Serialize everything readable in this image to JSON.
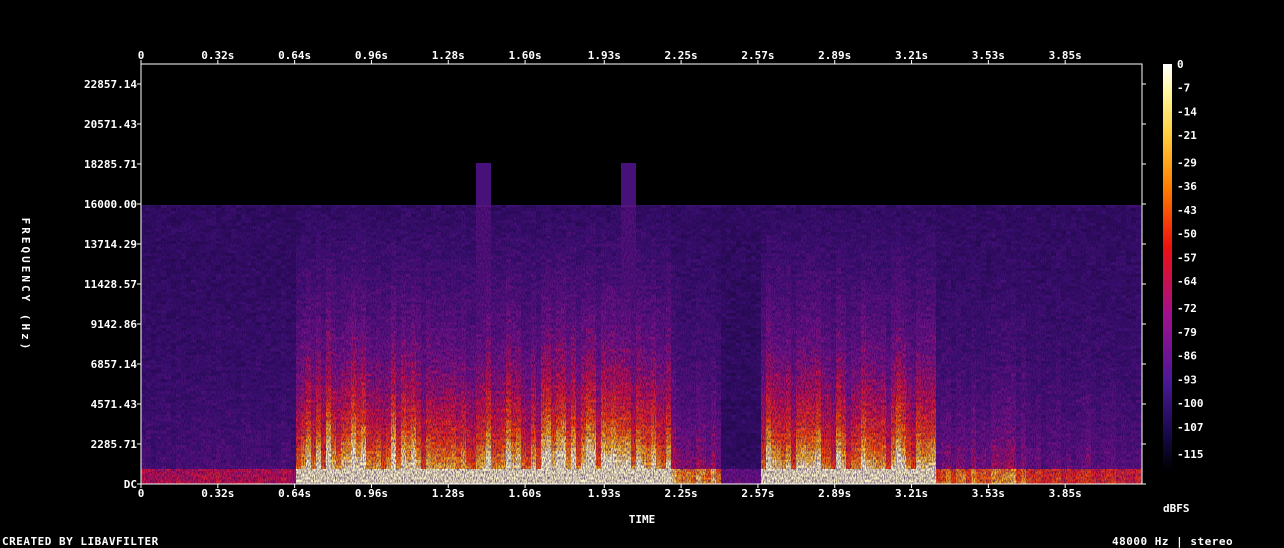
{
  "footer": {
    "left": "CREATED BY LIBAVFILTER",
    "right": "48000 Hz | stereo"
  },
  "chart_data": {
    "type": "heatmap",
    "title": "",
    "xlabel": "TIME",
    "ylabel": "FREQUENCY (Hz)",
    "x_unit": "s",
    "y_unit": "Hz",
    "xlim": [
      0,
      4.17
    ],
    "ylim": [
      0,
      24000
    ],
    "x_ticks": [
      "0",
      "0.32s",
      "0.64s",
      "0.96s",
      "1.28s",
      "1.60s",
      "1.93s",
      "2.25s",
      "2.57s",
      "2.89s",
      "3.21s",
      "3.53s",
      "3.85s"
    ],
    "x_tick_values": [
      0,
      0.32,
      0.64,
      0.96,
      1.28,
      1.6,
      1.93,
      2.25,
      2.57,
      2.89,
      3.21,
      3.53,
      3.85
    ],
    "y_ticks": [
      "DC",
      "2285.71",
      "4571.43",
      "6857.14",
      "9142.86",
      "11428.57",
      "13714.29",
      "16000.00",
      "18285.71",
      "20571.43",
      "22857.14"
    ],
    "y_tick_values": [
      0,
      2285.71,
      4571.43,
      6857.14,
      9142.86,
      11428.57,
      13714.29,
      16000,
      18285.71,
      20571.43,
      22857.14
    ],
    "colorbar": {
      "label": "dBFS",
      "ticks": [
        "0",
        "-7",
        "-14",
        "-21",
        "-29",
        "-36",
        "-43",
        "-50",
        "-57",
        "-64",
        "-72",
        "-79",
        "-86",
        "-93",
        "-100",
        "-107",
        "-115"
      ],
      "range": [
        -120,
        0
      ],
      "colormap": "fire: black-navy-purple-red-orange-yellow-white"
    },
    "signal_cutoff_hz": 16000,
    "loud_regions_s": [
      [
        0.64,
        2.2
      ],
      [
        2.57,
        3.3
      ]
    ],
    "transients_s": [
      1.42,
      2.02
    ],
    "grid": false,
    "legend": "colorbar-right"
  },
  "colors": {
    "background": "#000000",
    "text": "#ffffff",
    "axis": "#ffffff",
    "quiet": "#2a0a5e",
    "loud": "#ffd020"
  }
}
